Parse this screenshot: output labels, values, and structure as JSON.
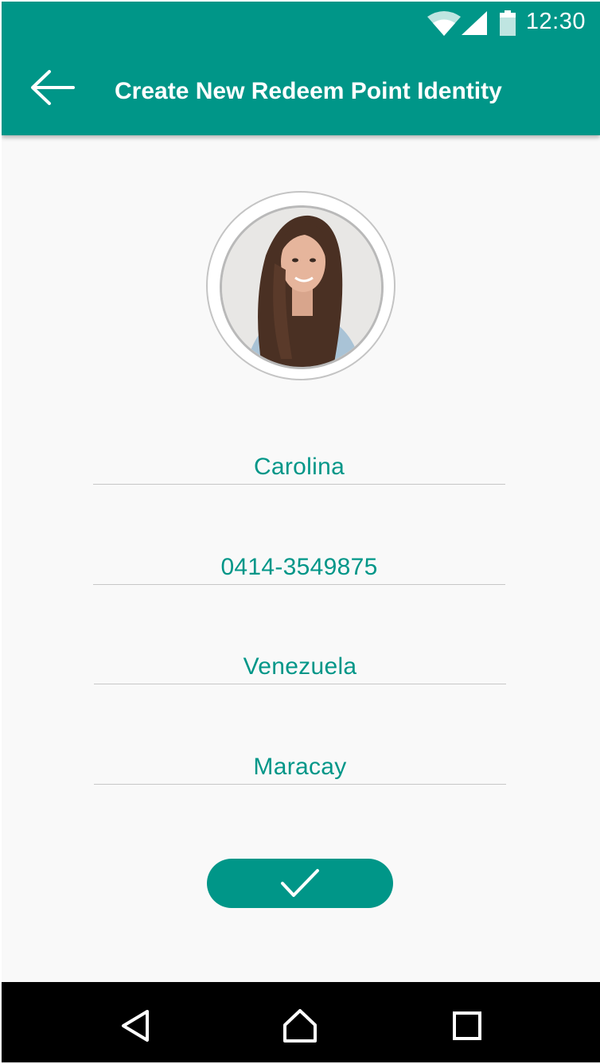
{
  "status_bar": {
    "time": "12:30",
    "icons": [
      "wifi-icon",
      "cell-signal-icon",
      "battery-icon"
    ]
  },
  "app_bar": {
    "title": "Create New Redeem Point Identity",
    "back_icon": "arrow-left-icon"
  },
  "profile": {
    "photo": "profile-photo"
  },
  "form": {
    "fields": [
      {
        "name": "name",
        "value": "Carolina"
      },
      {
        "name": "phone",
        "value": "0414-3549875"
      },
      {
        "name": "country",
        "value": "Venezuela"
      },
      {
        "name": "city",
        "value": "Maracay"
      }
    ]
  },
  "confirm_button": {
    "icon": "checkmark-icon"
  },
  "nav_bar": {
    "icons": [
      "back-triangle-icon",
      "home-icon",
      "recents-icon"
    ]
  },
  "colors": {
    "primary": "#009688",
    "background": "#f9f9f9",
    "divider": "#c7c7c7",
    "nav_bar": "#000000"
  }
}
